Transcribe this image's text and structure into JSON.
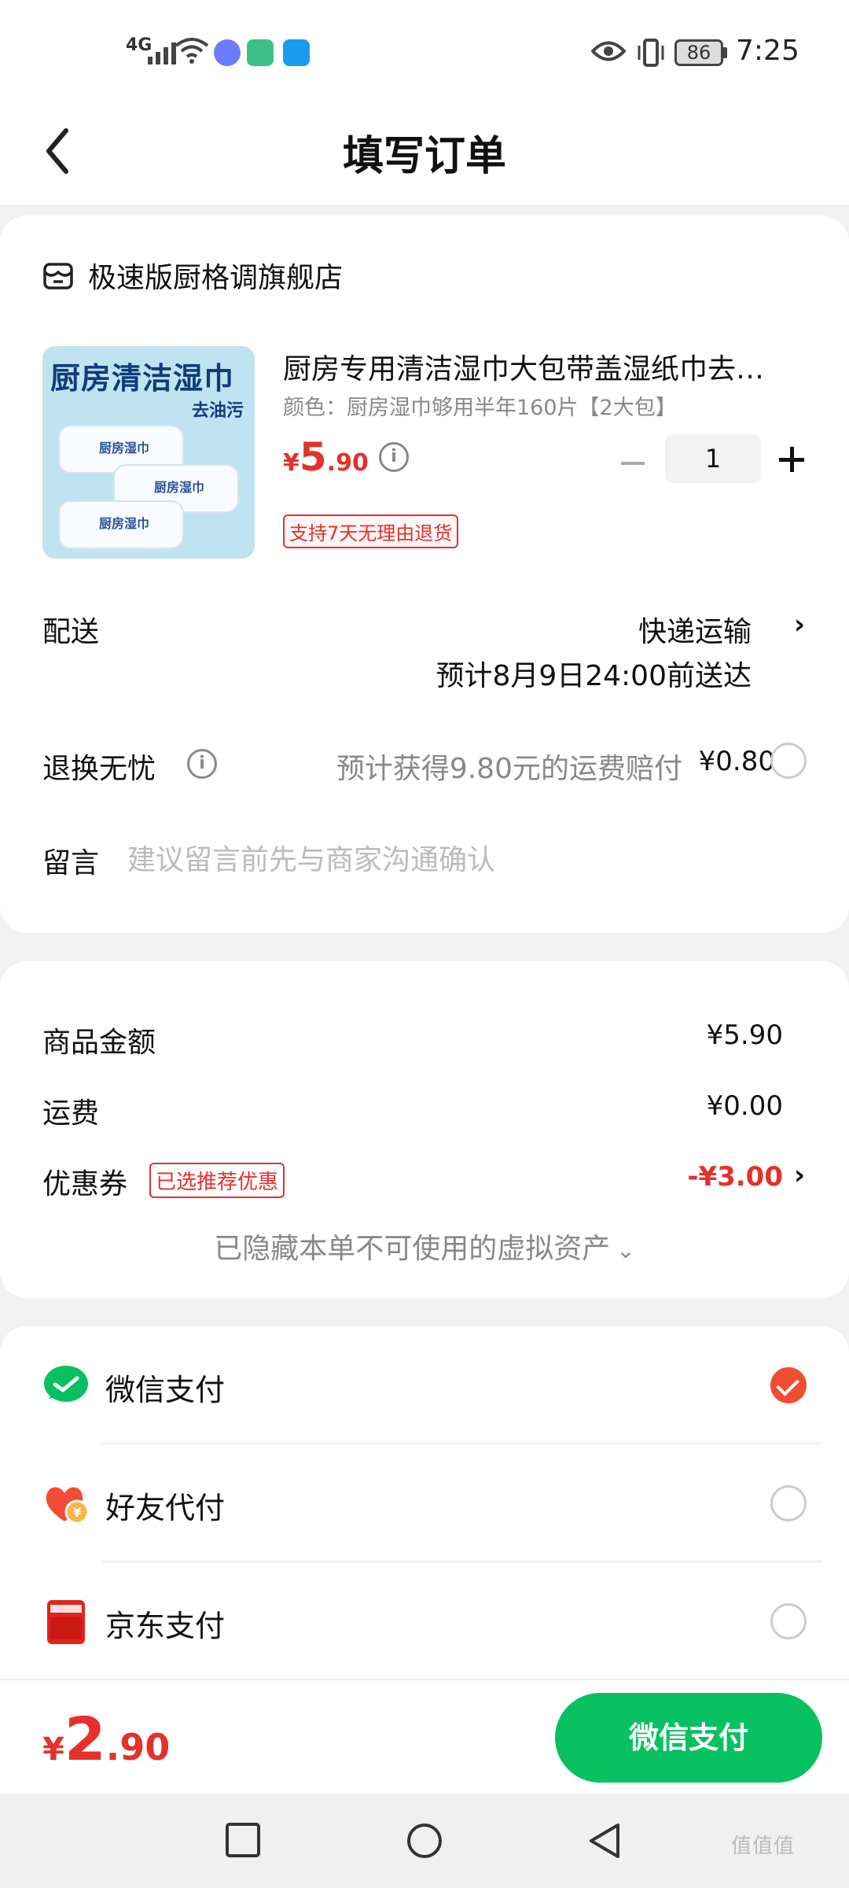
{
  "status_bar": {
    "network": "4G",
    "battery": "86",
    "time": "7:25"
  },
  "header": {
    "title": "填写订单"
  },
  "store": {
    "name": "极速版厨格调旗舰店"
  },
  "product": {
    "image_title": "厨房清洁湿巾",
    "image_subtitle": "去油污",
    "image_pack_label": "厨房湿巾",
    "title": "厨房专用清洁湿巾大包带盖湿纸巾去…",
    "spec": "颜色：厨房湿巾够用半年160片【2大包】",
    "price_currency": "¥",
    "price_int": "5",
    "price_dec": ".90",
    "quantity": "1",
    "return_tag": "支持7天无理由退货"
  },
  "delivery": {
    "label": "配送",
    "method": "快递运输",
    "eta": "预计8月9日24:00前送达"
  },
  "return_worry": {
    "label": "退换无忧",
    "text": "预计获得9.80元的运费赔付",
    "price": "¥0.80",
    "checked": false
  },
  "message": {
    "label": "留言",
    "placeholder": "建议留言前先与商家沟通确认",
    "value": ""
  },
  "amounts": {
    "goods_label": "商品金额",
    "goods_value": "¥5.90",
    "shipping_label": "运费",
    "shipping_value": "¥0.00",
    "coupon_label": "优惠券",
    "coupon_tag": "已选推荐优惠",
    "coupon_value": "-¥3.00",
    "hidden_note": "已隐藏本单不可使用的虚拟资产"
  },
  "payment_methods": [
    {
      "label": "微信支付",
      "icon": "wechat-pay-icon",
      "selected": true,
      "color": "#07c160"
    },
    {
      "label": "好友代付",
      "icon": "friend-pay-icon",
      "selected": false,
      "color": "#f04d32"
    },
    {
      "label": "京东支付",
      "icon": "jd-pay-icon",
      "selected": false,
      "color": "#e1251b"
    }
  ],
  "bottom": {
    "total_currency": "¥",
    "total_int": "2",
    "total_dec": ".90",
    "pay_button": "微信支付"
  },
  "watermark": "值值值",
  "colors": {
    "accent_green": "#07c160",
    "price_red": "#e5302b",
    "radio_checked": "#f04d32"
  }
}
